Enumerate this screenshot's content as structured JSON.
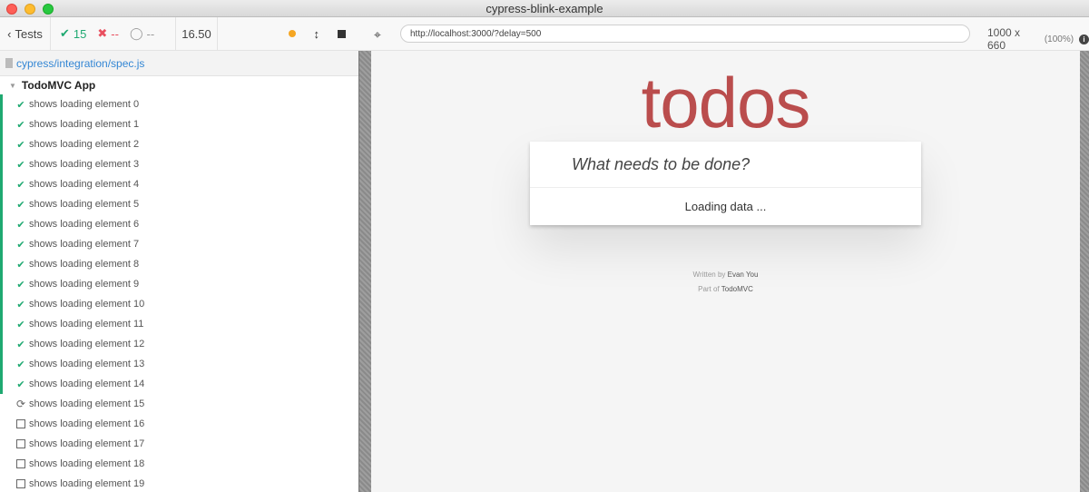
{
  "window": {
    "title": "cypress-blink-example"
  },
  "reporter": {
    "tests_button": "Tests",
    "passed_count": "15",
    "failed_count": "--",
    "pending_count": "--",
    "duration": "16.50",
    "spec_path": "cypress/integration/spec.js",
    "suite_title": "TodoMVC App",
    "tests": [
      {
        "title": "shows loading element 0",
        "state": "passed"
      },
      {
        "title": "shows loading element 1",
        "state": "passed"
      },
      {
        "title": "shows loading element 2",
        "state": "passed"
      },
      {
        "title": "shows loading element 3",
        "state": "passed"
      },
      {
        "title": "shows loading element 4",
        "state": "passed"
      },
      {
        "title": "shows loading element 5",
        "state": "passed"
      },
      {
        "title": "shows loading element 6",
        "state": "passed"
      },
      {
        "title": "shows loading element 7",
        "state": "passed"
      },
      {
        "title": "shows loading element 8",
        "state": "passed"
      },
      {
        "title": "shows loading element 9",
        "state": "passed"
      },
      {
        "title": "shows loading element 10",
        "state": "passed"
      },
      {
        "title": "shows loading element 11",
        "state": "passed"
      },
      {
        "title": "shows loading element 12",
        "state": "passed"
      },
      {
        "title": "shows loading element 13",
        "state": "passed"
      },
      {
        "title": "shows loading element 14",
        "state": "passed"
      },
      {
        "title": "shows loading element 15",
        "state": "running"
      },
      {
        "title": "shows loading element 16",
        "state": "pending"
      },
      {
        "title": "shows loading element 17",
        "state": "pending"
      },
      {
        "title": "shows loading element 18",
        "state": "pending"
      },
      {
        "title": "shows loading element 19",
        "state": "pending"
      }
    ]
  },
  "aut": {
    "url": "http://localhost:3000/?delay=500",
    "viewport": "1000 x 660",
    "viewport_pct": "(100%)"
  },
  "app": {
    "title": "todos",
    "new_todo_placeholder": "What needs to be done?",
    "loading_text": "Loading data ...",
    "footer_written_prefix": "Written by",
    "footer_author": "Evan You",
    "footer_part_prefix": "Part of",
    "footer_project": "TodoMVC"
  },
  "colors": {
    "passed": "#1fa971",
    "failed": "#e94f5f",
    "todos_title": "#af2f2f",
    "running_indicator": "#f5a623"
  },
  "icons": {
    "passed": "checkmark-icon",
    "failed": "x-icon",
    "pending": "circle-icon",
    "running": "refresh-icon",
    "queued": "square-icon"
  }
}
